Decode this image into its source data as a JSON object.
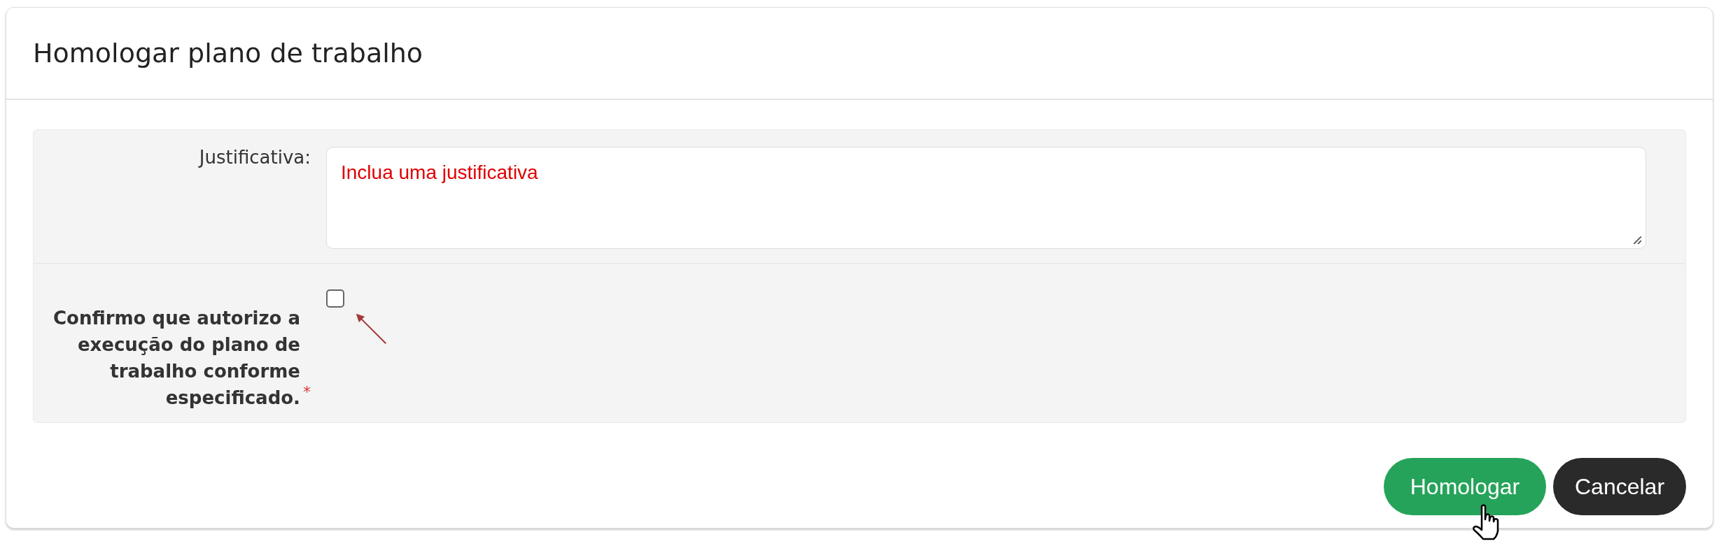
{
  "dialog": {
    "title": "Homologar plano de trabalho"
  },
  "form": {
    "justification": {
      "label": "Justificativa:",
      "placeholder": "Inclua uma justificativa"
    },
    "confirm": {
      "label": "Confirmo que autorizo a execução do plano de trabalho conforme especificado.",
      "required_mark": "*",
      "checked": false
    }
  },
  "buttons": [
    {
      "label": "Homologar",
      "kind": "primary"
    },
    {
      "label": "Cancelar",
      "kind": "secondary"
    }
  ]
}
